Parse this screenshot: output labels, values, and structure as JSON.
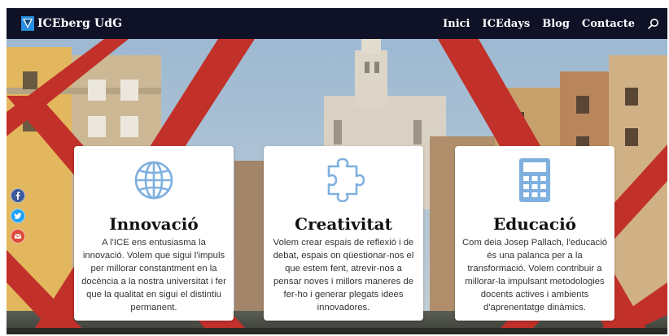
{
  "brand": {
    "name": "ICEberg UdG",
    "logo_icon": "iceberg-logo-icon",
    "bar_color": "#0f1226"
  },
  "nav": {
    "items": [
      {
        "label": "Inici"
      },
      {
        "label": "ICEdays"
      },
      {
        "label": "Blog"
      },
      {
        "label": "Contacte"
      }
    ],
    "search_icon": "search-icon"
  },
  "social": [
    {
      "icon": "facebook-icon",
      "color": "#3b5998"
    },
    {
      "icon": "twitter-icon",
      "color": "#1da1f2"
    },
    {
      "icon": "email-icon",
      "color": "#dd4b39"
    }
  ],
  "cards": [
    {
      "icon": "globe-icon",
      "title": "Innovació",
      "text": "A l'ICE ens entusiasma la innovació. Volem que sigui l'impuls per millorar constantment en la docència a la nostra universitat i fer que la qualitat en sigui el distintiu permanent."
    },
    {
      "icon": "puzzle-piece-icon",
      "title": "Creativitat",
      "text": "Volem crear espais de reflexió i de debat, espais on qüestionar-nos el que estem fent, atrevir-nos a pensar noves i millors maneres de fer-ho i generar plegats idees innovadores."
    },
    {
      "icon": "calculator-icon",
      "title": "Educació",
      "text": "Com deia Josep Pallach, l'educació és una palanca per a la transformació. Volem contribuir a millorar-la impulsant metodologies docents actives i ambients d'aprenentatge dinàmics."
    }
  ],
  "colors": {
    "icon_accent": "#7fb0e0",
    "bridge_red": "#c2302a"
  }
}
